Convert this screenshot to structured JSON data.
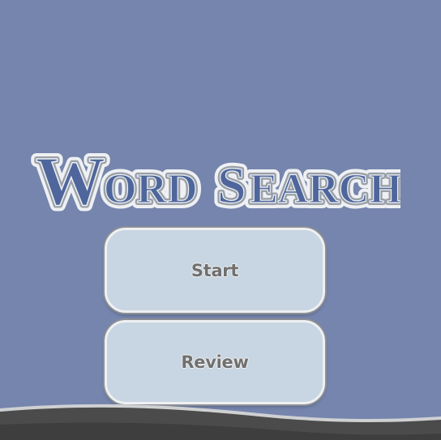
{
  "game": {
    "title_first_word": "Word",
    "title_second_word": "Search",
    "title_big_initial_1": "W",
    "title_rest_1": "ORD",
    "title_big_initial_2": "S",
    "title_rest_2": "EARCH"
  },
  "menu": {
    "start_label": "Start",
    "review_label": "Review"
  },
  "colors": {
    "background": "#7585ad",
    "title_fill": "#4e669c",
    "button_fill": "#c8d5e2",
    "wave_dark": "#4b4b4b"
  }
}
